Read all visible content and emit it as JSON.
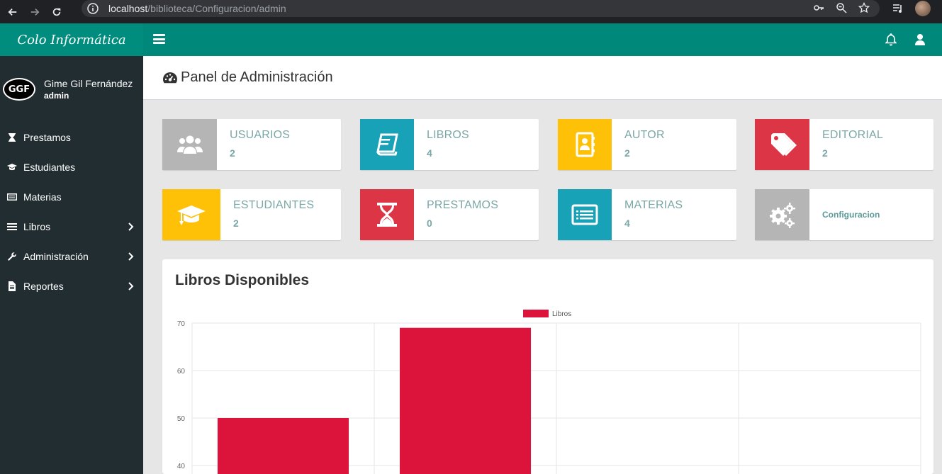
{
  "browser": {
    "url_host": "localhost",
    "url_path": "/biblioteca/Configuracion/admin"
  },
  "sidebar": {
    "brand": "Colo Informática",
    "user": {
      "name": "Gime Gil Fernández",
      "role": "admin",
      "avatar_text": "GGF"
    },
    "items": [
      {
        "label": "Prestamos",
        "icon": "hourglass-icon",
        "has_children": false
      },
      {
        "label": "Estudiantes",
        "icon": "graduation-cap-icon",
        "has_children": false
      },
      {
        "label": "Materias",
        "icon": "list-card-icon",
        "has_children": false
      },
      {
        "label": "Libros",
        "icon": "list-icon",
        "has_children": true
      },
      {
        "label": "Administración",
        "icon": "wrench-icon",
        "has_children": true
      },
      {
        "label": "Reportes",
        "icon": "file-icon",
        "has_children": true
      }
    ]
  },
  "header": {
    "page_title": "Panel de Administración"
  },
  "cards": [
    {
      "label": "USUARIOS",
      "value": "2",
      "color": "#b5b5b5",
      "icon": "users-icon"
    },
    {
      "label": "LIBROS",
      "value": "4",
      "color": "#17a2b8",
      "icon": "book-icon"
    },
    {
      "label": "AUTOR",
      "value": "2",
      "color": "#ffc107",
      "icon": "address-book-icon"
    },
    {
      "label": "EDITORIAL",
      "value": "2",
      "color": "#dc3545",
      "icon": "tags-icon"
    },
    {
      "label": "ESTUDIANTES",
      "value": "2",
      "color": "#ffc107",
      "icon": "graduation-cap-icon"
    },
    {
      "label": "PRESTAMOS",
      "value": "0",
      "color": "#dc3545",
      "icon": "hourglass-icon"
    },
    {
      "label": "MATERIAS",
      "value": "4",
      "color": "#17a2b8",
      "icon": "list-card-icon"
    },
    {
      "label": "Configuracion",
      "value": "",
      "color": "#b5b5b5",
      "icon": "gears-icon"
    }
  ],
  "chart_box": {
    "title": "Libros Disponibles"
  },
  "chart_data": {
    "type": "bar",
    "series": [
      {
        "name": "Libros",
        "color": "#dc143c",
        "values": [
          50,
          69
        ]
      }
    ],
    "categories": [
      "",
      "",
      "",
      ""
    ],
    "ylim": [
      0,
      70
    ],
    "y_ticks": [
      40,
      50,
      60,
      70
    ],
    "grid": true,
    "legend": "top-center"
  }
}
